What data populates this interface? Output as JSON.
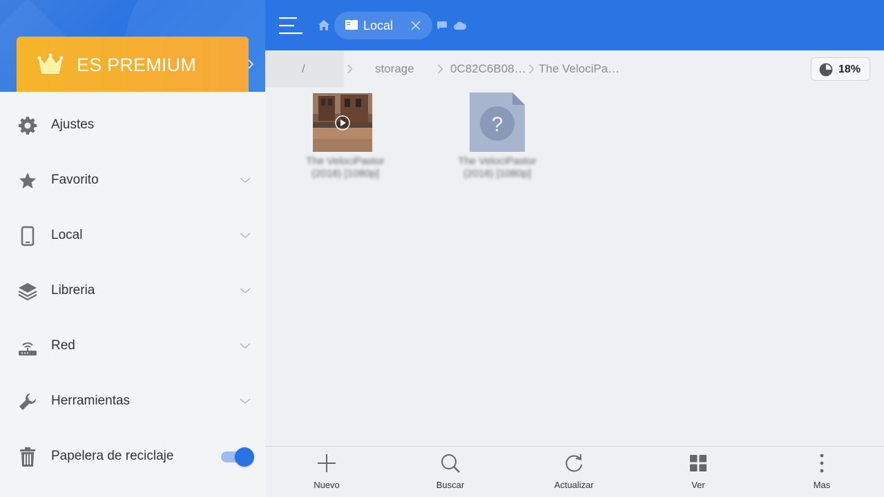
{
  "sidebar": {
    "premium_label": "ES PREMIUM",
    "items": [
      {
        "label": "Ajustes",
        "icon": "gear-icon"
      },
      {
        "label": "Favorito",
        "icon": "star-icon"
      },
      {
        "label": "Local",
        "icon": "phone-icon"
      },
      {
        "label": "Libreria",
        "icon": "layers-icon"
      },
      {
        "label": "Red",
        "icon": "router-icon"
      },
      {
        "label": "Herramientas",
        "icon": "wrench-icon"
      },
      {
        "label": "Papelera de reciclaje",
        "icon": "trash-icon",
        "toggle_on": true
      }
    ]
  },
  "topbar": {
    "active_tab": "Local"
  },
  "breadcrumb": {
    "root": "/",
    "parts": [
      "storage",
      "0C82C6B08…",
      "The VelociPa…"
    ]
  },
  "storage": {
    "percent": "18%"
  },
  "files": [
    {
      "name": "The VelociPastor (2018) [1080p]",
      "type": "video"
    },
    {
      "name": "The VelociPastor (2018) [1080p]",
      "type": "unknown"
    }
  ],
  "toolbar": {
    "new": "Nuevo",
    "search": "Buscar",
    "refresh": "Actualizar",
    "view": "Ver",
    "more": "Mas"
  },
  "colors": {
    "primary": "#2a74e3",
    "premium": "#f7a93a",
    "sidebar_bg": "#f3f4f6",
    "content_bg": "#eef0f3"
  }
}
